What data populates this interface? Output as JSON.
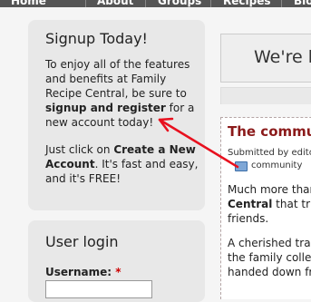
{
  "nav": {
    "items": [
      "Home",
      "About",
      "Groups",
      "Recipes",
      "Blo"
    ]
  },
  "signup": {
    "title": "Signup Today!",
    "p1_a": "To enjoy all of the features and benefits at Family Recipe Central, be sure to ",
    "p1_bold": "signup and register",
    "p1_b": " for a new account today!",
    "p2_a": "Just click on ",
    "p2_bold": "Create a New Account",
    "p2_b": ". It's fast and easy, and it's FREE!"
  },
  "login": {
    "title": "User login",
    "username_label": "Username:",
    "required_mark": "*",
    "username_value": ""
  },
  "welcome": {
    "text": "We're b"
  },
  "article": {
    "title": "The commun",
    "submitted": "Submitted by editor",
    "tag": "community",
    "p1_a": "Much more than",
    "p1_b": "Central",
    "p1_c": " that trul",
    "p1_d": "friends.",
    "p2_a": "A cherished trad",
    "p2_b": "the family collec",
    "p2_c": "handed down fro"
  },
  "colors": {
    "arrow": "#e8101e",
    "article_title": "#8b1a1a"
  }
}
